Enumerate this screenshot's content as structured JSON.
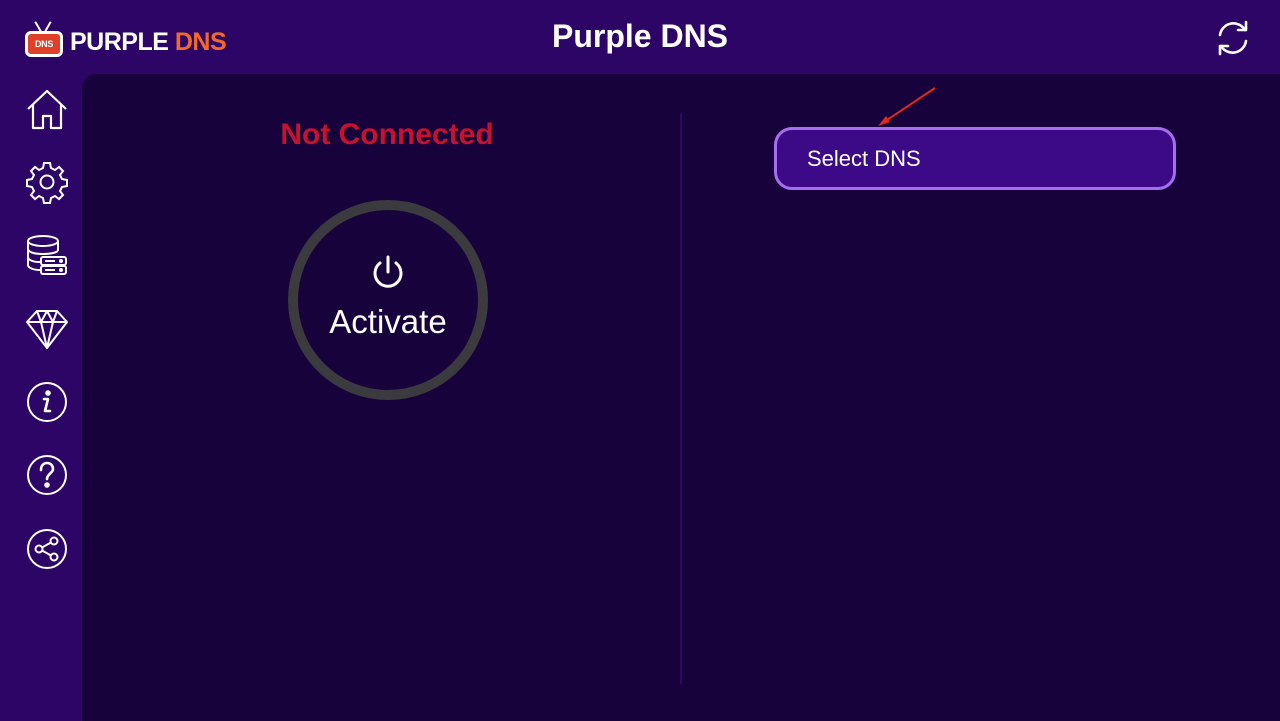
{
  "header": {
    "logo_icon_text": "DNS",
    "logo_word1": "PURPLE",
    "logo_word2": "DNS",
    "title": "Purple DNS"
  },
  "sidebar": {
    "items": [
      {
        "icon": "home-icon"
      },
      {
        "icon": "gear-icon"
      },
      {
        "icon": "database-icon"
      },
      {
        "icon": "diamond-icon"
      },
      {
        "icon": "info-icon"
      },
      {
        "icon": "help-icon"
      },
      {
        "icon": "share-icon"
      }
    ]
  },
  "main": {
    "status": "Not Connected",
    "activate_label": "Activate",
    "select_label": "Select DNS"
  },
  "colors": {
    "background": "#2c0566",
    "panel": "#18023c",
    "status_red": "#c5122e",
    "select_fill": "#3c0a86",
    "select_border": "#a56ef0",
    "logo_orange": "#ef6a2b",
    "annotation_arrow": "#e0281f"
  }
}
